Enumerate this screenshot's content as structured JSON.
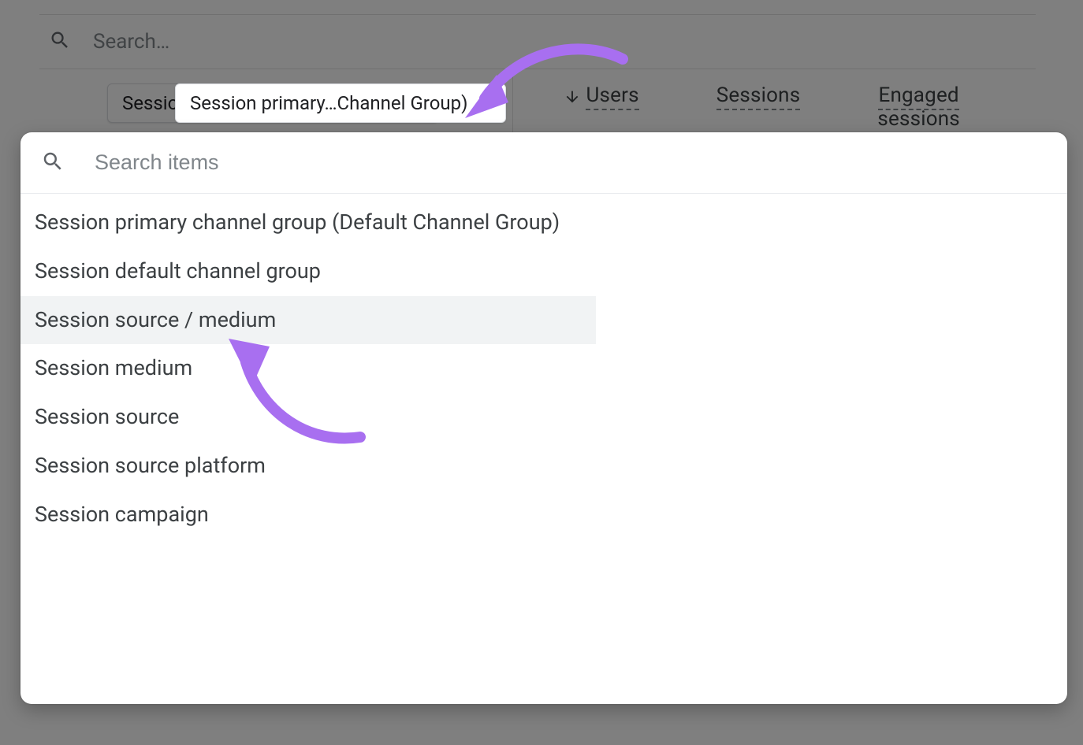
{
  "top_search": {
    "placeholder": "Search…"
  },
  "dimension_dropdown": {
    "label": "Session primary…Channel Group)"
  },
  "metrics": {
    "users": "Users",
    "sessions": "Sessions",
    "engaged_line1": "Engaged",
    "engaged_line2": "sessions"
  },
  "panel": {
    "search_placeholder": "Search items",
    "items": [
      "Session primary channel group (Default Channel Group)",
      "Session default channel group",
      "Session source / medium",
      "Session medium",
      "Session source",
      "Session source platform",
      "Session campaign"
    ],
    "hovered_index": 2
  }
}
